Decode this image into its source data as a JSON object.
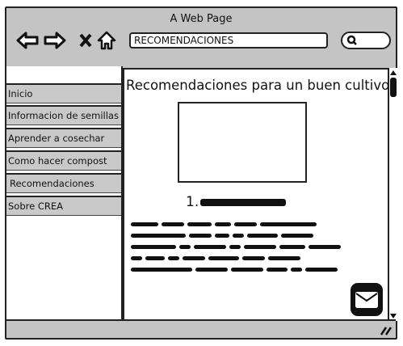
{
  "window": {
    "title": "A Web Page",
    "url": "RECOMENDACIONES"
  },
  "sidebar": {
    "items": [
      {
        "label": "Inicio"
      },
      {
        "label": "Informacion de semillas"
      },
      {
        "label": "Aprender a cosechar"
      },
      {
        "label": "Como hacer compost"
      },
      {
        "label": "Recomendaciones"
      },
      {
        "label": "Sobre CREA"
      }
    ]
  },
  "content": {
    "heading": "Recomendaciones para un buen cultivo",
    "list_number": "1."
  },
  "icons": [
    "back-arrow-icon",
    "forward-arrow-icon",
    "close-icon",
    "home-icon",
    "search-icon",
    "mail-icon",
    "resize-grip-icon"
  ]
}
